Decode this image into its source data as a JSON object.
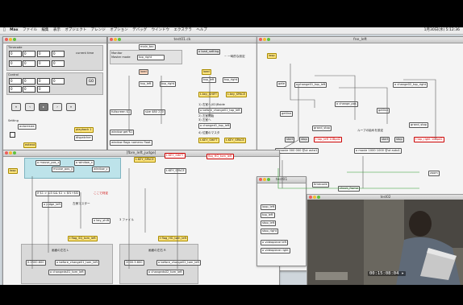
{
  "menubar": {
    "apple": "",
    "items": [
      "Max",
      "ファイル",
      "編集",
      "表示",
      "オブジェクト",
      "アレンジ",
      "オプション",
      "デバッグ",
      "ウインドウ",
      "エクステラ",
      "ヘルプ"
    ],
    "right": "1月30日(水) 5:12:36"
  },
  "windows": {
    "top_left": {
      "title": ""
    },
    "center": {
      "title": "test01.ck"
    },
    "right": {
      "title": "fne_left"
    },
    "bottom_left": {
      "title": "[fbre_left_judge]"
    },
    "right_bottom": {
      "title": "test01"
    },
    "video": {
      "title": "test02"
    }
  },
  "top_left": {
    "label_timecode": "Timecode",
    "label_current": "current time",
    "label_control": "Control",
    "label_setting": "Setting",
    "label_autoresize": "autoresize",
    "label_dispatcher": "dispatcher",
    "label_playback": "playback 1",
    "label_extend": "extend",
    "btn_go": "GO"
  },
  "center": {
    "monitor_title": "Monitor",
    "monitor_mode": "Master mode",
    "mode_value": "top_right",
    "main_tax": "main_tax",
    "o_load_setting": "o load_setting",
    "setting_sub": "~ 一時的な設定",
    "load": "load",
    "top_left": "top_left",
    "top_right": "top_right",
    "k_obj": "t-key_SHIFT",
    "k_space": "t-key_SPACE",
    "txt1": "1) 右室へ(02)Bside",
    "txt2": "2) 左室開始",
    "txt3": "3) 左室へ",
    "txt4": "4) 位置のマスタ",
    "o_fullscreen": "fullscreen $1",
    "o_size": "size 480 270",
    "o_window": "window get $1",
    "o_change": "o changed1_top_left",
    "o_before": "o before_change01_top_left",
    "window_flags": "window flags nomenu float",
    "o_bfrange": "o bframe",
    "key_shift": "t-KEY_SHIFT",
    "key_space": "t-KEY_SPACE",
    "f_top": "fbq_HG_tom_left"
  },
  "right": {
    "loop": "loop",
    "gate": "gate",
    "change01": "o change01_top_left",
    "change02": "o change02_top_right",
    "getline": "getline",
    "position": "position $1",
    "change_pos": "o change_pos",
    "grand_stop": "grand_stop",
    "start": "start",
    "stop": "stop",
    "pos_left": "t top_left 10Bpd2",
    "pos_right": "t top_right 10Bpd2",
    "text_layer": "ループの始めを設定",
    "movie1": "o movie 000 000 @ut auto1",
    "movie2": "o movie 1000 1000 @ut auto1",
    "timecode": "timecode",
    "check_frame": "check_frame",
    "frame_zero": "frame_zero",
    "zoom": "zoom"
  },
  "bottom_left": {
    "o_mouse_pos_x": "o mouse_pos_x",
    "o_window_x": "o window_x",
    "mouse_pos_y": "mouse_pos_y",
    "window_y": "window_y",
    "calc": "if $1 > $i3 && $1 < $f1+$f2",
    "calc_note": "ここで判定",
    "o_judge": "o judge_left",
    "judge_note": "左側マスター",
    "o_key": "o key_shift",
    "key_note": "3 ファイル",
    "flag1": "t flag_SQ_tom_left",
    "flag2": "t flag_HG_tom_left",
    "num1": "0.2500.600",
    "num2": "2000.3.600",
    "before1": "o before_change01_tom_left",
    "before2": "o before_change02_tom_left",
    "change1": "o changeds01_tom_left",
    "change2": "o changeds02_tom_left",
    "note1": "画面の左右 L",
    "note2": "画面の左右 R",
    "key_space": "t-KEY_SPACE",
    "key_space2": "t-KEY_SPACE",
    "key_shift": "t-KEY_SHIFT"
  },
  "right_bottom": {
    "loop_left": "loop_left",
    "top_left_t": "top_left",
    "stop_left": "stop_left",
    "stop_right": "stop_right",
    "video_left": "o videoplane left",
    "video_right": "o videoplane right"
  },
  "video": {
    "timecode": "00:15:08:04 ▸"
  },
  "colors": {
    "cyan_panel": "#bde3ea",
    "yellow_obj": "#ffe680",
    "red_text": "#cc0000"
  }
}
